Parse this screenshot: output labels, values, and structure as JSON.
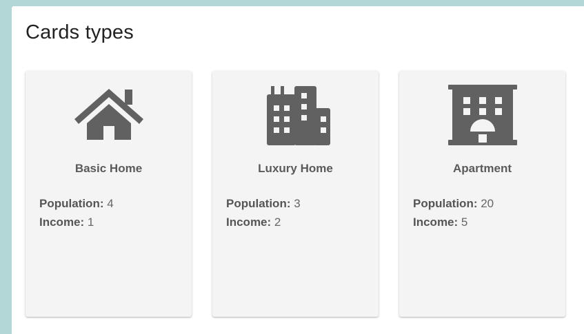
{
  "page": {
    "title": "Cards types"
  },
  "cards": [
    {
      "title": "Basic Home",
      "icon": "house-icon",
      "population_label": "Population:",
      "population_value": "4",
      "income_label": "Income:",
      "income_value": "1"
    },
    {
      "title": "Luxury Home",
      "icon": "city-buildings-icon",
      "population_label": "Population:",
      "population_value": "3",
      "income_label": "Income:",
      "income_value": "2"
    },
    {
      "title": "Apartment",
      "icon": "apartment-building-icon",
      "population_label": "Population:",
      "population_value": "20",
      "income_label": "Income:",
      "income_value": "5"
    }
  ],
  "colors": {
    "background": "#b3d6d6",
    "panel": "#ffffff",
    "card": "#f4f4f4",
    "icon": "#616161"
  }
}
